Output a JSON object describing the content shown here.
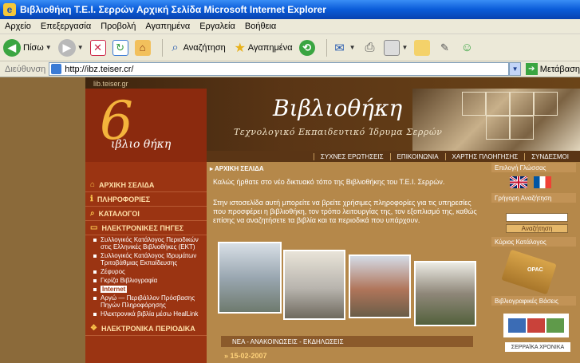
{
  "window": {
    "title": "Βιβλιοθήκη Τ.Ε.Ι. Σερρών   Αρχική Σελίδα   Microsoft Internet Explorer"
  },
  "menu": [
    "Αρχείο",
    "Επεξεργασία",
    "Προβολή",
    "Αγαπημένα",
    "Εργαλεία",
    "Βοήθεια"
  ],
  "toolbar": {
    "back_label": "Πίσω",
    "search_label": "Αναζήτηση",
    "favorites_label": "Αγαπημένα"
  },
  "address": {
    "label": "Διεύθυνση",
    "url": "http://ibz.teiser.cr/",
    "go_label": "Μετάβαση"
  },
  "site": {
    "domain": "lib.teiser.gr",
    "logo_digit": "6",
    "logo_word": "ιβλιο θήκη",
    "title": "Βιβλιοθήκη",
    "subtitle": "Τεχνολογικό Εκπαιδευτικό Ίδρυμα Σερρών",
    "topnav": [
      "ΣΥΧΝΕΣ ΕΡΩΤΗΣΕΙΣ",
      "ΕΠΙΚΟΙΝΩΝΙΑ",
      "ΧΑΡΤΗΣ ΠΛΟΗΓΗΣΗΣ",
      "ΣΥΝΔΕΣΜΟΙ"
    ],
    "leftnav": {
      "home": "ΑΡΧΙΚΗ ΣΕΛΙΔΑ",
      "info": "ΠΛΗΡΟΦΟΡΙΕΣ",
      "catalogs": "ΚΑΤΑΛΟΓΟΙ",
      "electronic_sources": "ΗΛΕΚΤΡΟΝΙΚΕΣ ΠΗΓΕΣ",
      "subitems": [
        "Συλλογικός Κατάλογος Περιοδικών στις Ελληνικές Βιβλιοθήκες (ΕΚΤ)",
        "Συλλογικός Κατάλογος Ιδρυμάτων Τριτοβάθμιας Εκπαίδευσης",
        "Ζέφυρος",
        "Γκρίζα Βιβλιογραφία",
        "Internet",
        "Αργώ — Περιβάλλον Πρόσβασης Πηγών Πληροφόρησης",
        "Ηλεκτρονικά βιβλία μέσω HealLink"
      ],
      "active_index": 4,
      "periodicals": "ΗΛΕΚΤΡΟΝΙΚΑ ΠΕΡΙΟΔΙΚΑ"
    },
    "main": {
      "breadcrumb": "ΑΡΧΙΚΗ ΣΕΛΙΔΑ",
      "welcome": "Καλώς ήρθατε στο νέο δικτυακό τόπο της Βιβλιοθήκης του Τ.Ε.Ι. Σερρών.",
      "intro": "Στην ιστοσελίδα αυτή μπορείτε να βρείτε χρήσιμες πληροφορίες για τις υπηρεσίες που προσφέρει η βιβλιοθήκη, τον τρόπο λειτουργίας της, τον εξοπλισμό της, καθώς επίσης να αναζητήσετε τα βιβλία και τα περιοδικά που υπάρχουν.",
      "news_header": "ΝΕΑ - ΑΝΑΚΟΙΝΩΣΕΙΣ - ΕΚΔΗΛΩΣΕΙΣ",
      "news_date": "15-02-2007"
    },
    "right": {
      "language_label": "Επιλογή Γλώσσας",
      "search_label": "Γρήγορη Αναζήτηση",
      "search_button": "Αναζήτηση",
      "catalog_label": "Κύριος Κατάλογος",
      "opac": "OPAC",
      "bibliographic_label": "Βιβλιογραφικές Βάσεις",
      "serraika": "ΣΕΡΡΑΪΚΑ ΧΡΟΝΙΚΑ"
    }
  }
}
